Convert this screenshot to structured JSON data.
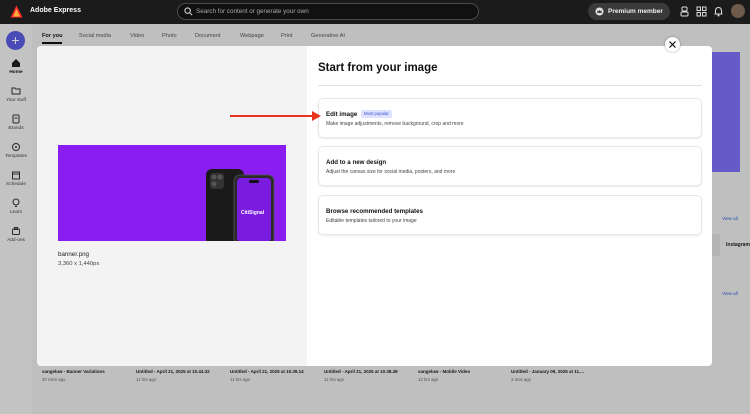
{
  "app": {
    "title": "Adobe Express"
  },
  "search": {
    "placeholder": "Search for content or generate your own"
  },
  "header": {
    "premium_label": "Premium member"
  },
  "sidebar": {
    "items": [
      {
        "label": "Home",
        "icon": "home-icon"
      },
      {
        "label": "Your stuff",
        "icon": "folder-icon"
      },
      {
        "label": "Brands",
        "icon": "brand-icon"
      },
      {
        "label": "Templates",
        "icon": "templates-icon"
      },
      {
        "label": "Schedule",
        "icon": "calendar-icon"
      },
      {
        "label": "Learn",
        "icon": "lightbulb-icon"
      },
      {
        "label": "Add-ons",
        "icon": "addons-icon"
      }
    ]
  },
  "tabs": [
    "For you",
    "Social media",
    "Video",
    "Photo",
    "Document",
    "Webpage",
    "Print",
    "Generative AI"
  ],
  "background": {
    "view_all": "View all",
    "instagram": "Instagram",
    "recent": [
      {
        "title": "vangeluw - Banner Variations",
        "time": "20 mins ago"
      },
      {
        "title": "Untitled - April 21, 2025 at 10.44.32",
        "time": "11 hrs ago"
      },
      {
        "title": "Untitled - April 21, 2025 at 10.39.14",
        "time": "11 hrs ago"
      },
      {
        "title": "Untitled - April 21, 2025 at 10.38.49",
        "time": "11 hrs ago"
      },
      {
        "title": "vangeluw - Mobile Video",
        "time": "12 hrs ago"
      },
      {
        "title": "Untitled - January 09, 2025 at 11....",
        "time": "3 mos ago"
      }
    ]
  },
  "modal": {
    "title": "Start from your image",
    "file_name": "banner.png",
    "file_dims": "3,360 x 1,440px",
    "preview_brand": "CitiSignal",
    "options": [
      {
        "title": "Edit image",
        "badge": "Most popular",
        "desc": "Make image adjustments, remove background, crop and more"
      },
      {
        "title": "Add to a new design",
        "desc": "Adjust the canvas size for social media, posters, and more"
      },
      {
        "title": "Browse recommended templates",
        "desc": "Editable templates tailored to your image"
      }
    ]
  },
  "colors": {
    "accent": "#5c5ce0",
    "preview_bg": "#8a1ef0",
    "arrow": "#e8321e",
    "badge_bg": "#dde3ff"
  }
}
